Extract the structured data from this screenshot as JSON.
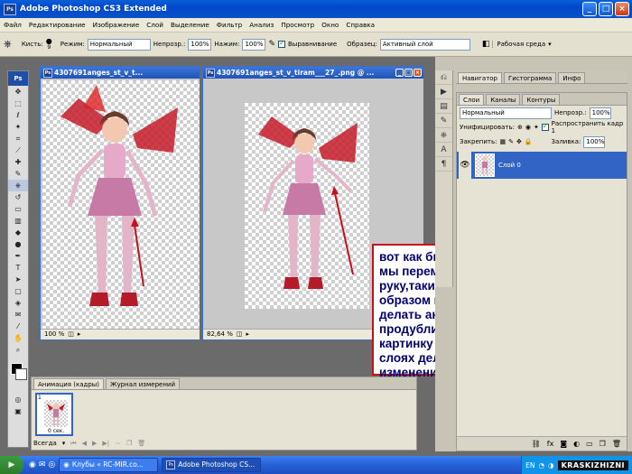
{
  "app": {
    "title": "Adobe Photoshop CS3 Extended",
    "logo": "Ps",
    "toolbox_logo": "Ps"
  },
  "menu": [
    "Файл",
    "Редактирование",
    "Изображение",
    "Слой",
    "Выделение",
    "Фильтр",
    "Анализ",
    "Просмотр",
    "Окно",
    "Справка"
  ],
  "options": {
    "brush_label": "Кисть:",
    "brush_size": "9",
    "mode_label": "Режим:",
    "mode_value": "Нормальный",
    "opacity_label": "Непрозр.:",
    "opacity_value": "100%",
    "flow_label": "Нажим:",
    "flow_value": "100%",
    "aligned_label": "Выравнивание",
    "sample_label": "Образец:",
    "sample_value": "Активный слой",
    "workspace_label": "Рабочая среда"
  },
  "doc1": {
    "title": "4307691anges_st_v_t...",
    "zoom": "100 %"
  },
  "doc2": {
    "title": "4307691anges_st_v_tiram___27_.png @ ...",
    "zoom": "82,64 %"
  },
  "annotation": "вот как было  и как мы переместили руку,таким образом можно делать анимашку продублировав картинку и на слоях делать изменения",
  "animation": {
    "tab_active": "Анимация (кадры)",
    "tab_other": "Журнал измерений",
    "frame_number": "1",
    "frame_delay": "0 сек.",
    "loop": "Всегда"
  },
  "panels": {
    "top_tabs": [
      "Навигатор",
      "Гистограмма",
      "Инфо"
    ],
    "layer_tabs": [
      "Слои",
      "Каналы",
      "Контуры"
    ],
    "blend_mode": "Нормальный",
    "opacity_label": "Непрозр.:",
    "opacity_value": "100%",
    "unify_label": "Унифицировать:",
    "propagate_label": "Распространить кадр 1",
    "lock_label": "Закрепить:",
    "fill_label": "Заливка:",
    "fill_value": "100%",
    "layer_name": "Слой 0"
  },
  "taskbar": {
    "start": "▶",
    "items": [
      "Клубы « RC-MIR.co...",
      "Adobe Photoshop CS..."
    ],
    "lang": "EN",
    "watermark": "KRASKIZHIZNI"
  },
  "colors": {
    "accent": "#0a5fd8",
    "annotation_border": "#c8101d",
    "annotation_text": "#00006e",
    "layer_selected": "#3164c4",
    "arrow": "#c8101d"
  },
  "icons": [
    "photoshop-icon",
    "minimize-icon",
    "maximize-icon",
    "close-icon",
    "brush-icon",
    "clone-stamp-icon",
    "eye-icon",
    "lock-icon",
    "link-icon",
    "trash-icon",
    "new-layer-icon",
    "play-icon"
  ]
}
